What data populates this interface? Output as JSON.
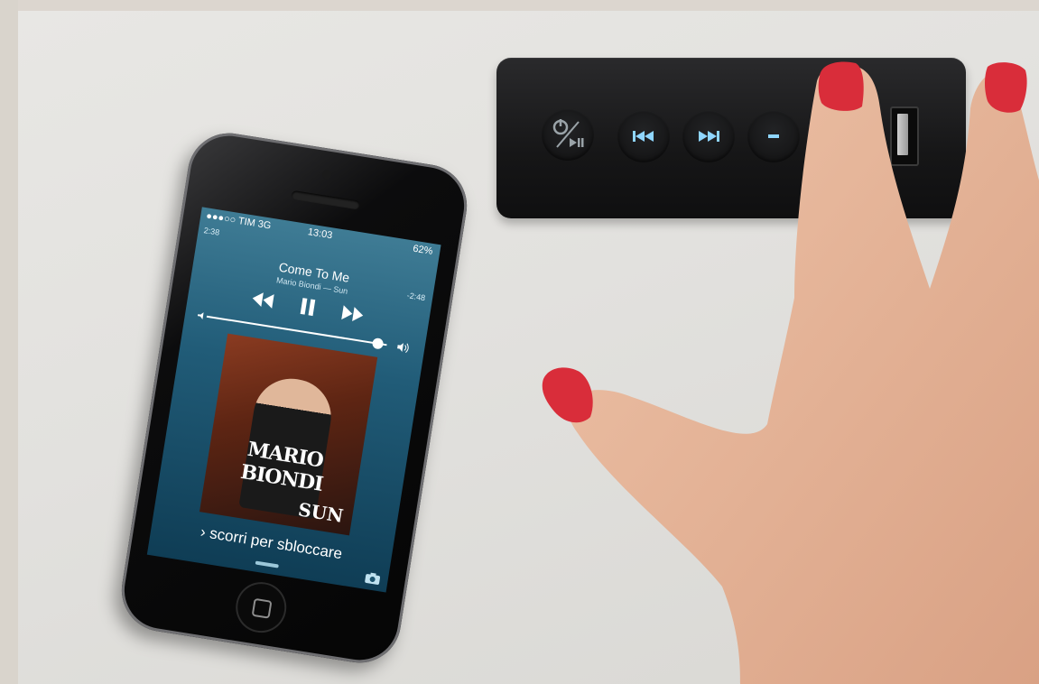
{
  "phone": {
    "status": {
      "carrier": "●●●○○ TIM  3G",
      "time": "13:03",
      "battery": "62%"
    },
    "elapsed": "2:38",
    "remaining": "-2:48",
    "song_title": "Come To Me",
    "song_subtitle": "Mario Biondi — Sun",
    "cover": {
      "artist": "MARIO BIONDI",
      "album": "SUN"
    },
    "unlock_text": "› scorri per sbloccare",
    "volume_level": 0.95
  },
  "control_bar": {
    "buttons": [
      "power-play-pause-icon",
      "previous-track-icon",
      "next-track-icon",
      "volume-down-icon"
    ],
    "accent_color": "#8fd6ff"
  },
  "colors": {
    "background": "#e3e2df",
    "nail": "#d92d3a",
    "skin": "#e6b69c"
  }
}
